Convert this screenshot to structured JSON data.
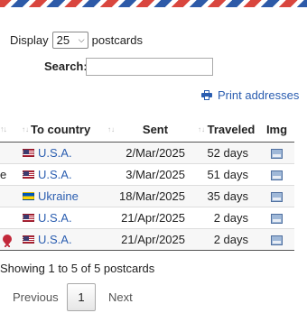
{
  "controls": {
    "display_label": "Display",
    "display_value": "25",
    "display_suffix": "postcards",
    "search_label": "Search:",
    "search_value": ""
  },
  "print_link": "Print addresses",
  "table": {
    "headers": [
      "To country",
      "Sent",
      "Traveled",
      "Img"
    ],
    "first_col_fragment": "e",
    "rows": [
      {
        "flag": "us-flag-icon",
        "country": "U.S.A.",
        "sent": "2/Mar/2025",
        "traveled": "52 days",
        "marker": ""
      },
      {
        "flag": "us-flag-icon",
        "country": "U.S.A.",
        "sent": "3/Mar/2025",
        "traveled": "51 days",
        "marker": "e"
      },
      {
        "flag": "ukraine-flag-icon",
        "country": "Ukraine",
        "sent": "18/Mar/2025",
        "traveled": "35 days",
        "marker": ""
      },
      {
        "flag": "us-flag-icon",
        "country": "U.S.A.",
        "sent": "21/Apr/2025",
        "traveled": "2 days",
        "marker": ""
      },
      {
        "flag": "us-flag-icon",
        "country": "U.S.A.",
        "sent": "21/Apr/2025",
        "traveled": "2 days",
        "marker": "award-ribbon-icon"
      }
    ]
  },
  "info": "Showing 1 to 5 of 5 postcards",
  "pagination": {
    "previous": "Previous",
    "current": "1",
    "next": "Next"
  },
  "colors": {
    "link": "#2a5db0",
    "airmail_red": "#d9463e",
    "airmail_blue": "#2d5aa8"
  }
}
